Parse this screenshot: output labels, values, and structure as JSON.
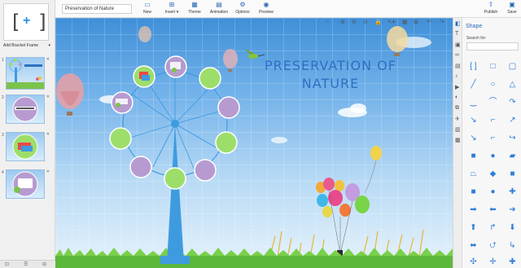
{
  "toolbar": {
    "title_value": "Preservation of Nature",
    "buttons": [
      {
        "label": "New",
        "icon": "new-file-icon",
        "glyph": "▭"
      },
      {
        "label": "Insert",
        "icon": "insert-icon",
        "glyph": "⊞"
      },
      {
        "label": "Theme",
        "icon": "theme-icon",
        "glyph": "▦"
      },
      {
        "label": "Animation",
        "icon": "animation-icon",
        "glyph": "▤"
      },
      {
        "label": "Options",
        "icon": "gear-icon",
        "glyph": "⚙"
      },
      {
        "label": "Preview",
        "icon": "preview-icon",
        "glyph": "◉"
      },
      {
        "label": "Publish",
        "icon": "publish-icon",
        "glyph": "⇧"
      },
      {
        "label": "Save",
        "icon": "save-icon",
        "glyph": "▣"
      }
    ]
  },
  "left_panel": {
    "add_bracket_label": "Add Bracket Frame",
    "slides": [
      {
        "num": "1"
      },
      {
        "num": "2"
      },
      {
        "num": "3"
      },
      {
        "num": "4"
      }
    ]
  },
  "canvas": {
    "title_line1": "PRESERVATION OF",
    "title_line2": "NATURE"
  },
  "right_panel": {
    "tab_title": "Shape",
    "search_label": "Search for:"
  },
  "colors": {
    "accent": "#2a6bb8",
    "title_text": "#2f6fc2",
    "circle_green": "#9dde6a",
    "circle_purple": "#b79bd0",
    "tower": "#3f9be0",
    "shape_icon": "#2f7fd8"
  }
}
